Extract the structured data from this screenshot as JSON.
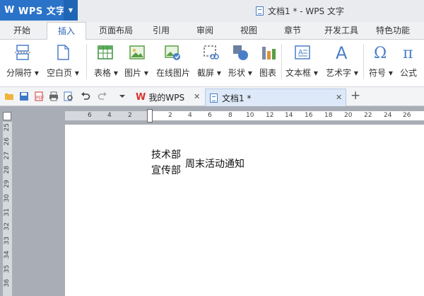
{
  "app": {
    "name": "WPS 文字",
    "logo": "W"
  },
  "window": {
    "title": "文档1 * - WPS 文字"
  },
  "menu": {
    "tabs": [
      "开始",
      "插入",
      "页面布局",
      "引用",
      "审阅",
      "视图",
      "章节",
      "开发工具",
      "特色功能"
    ],
    "active": "插入"
  },
  "ribbon": {
    "items": [
      {
        "label": "分隔符",
        "icon": "page-break-icon",
        "dropdown": true
      },
      {
        "label": "空白页",
        "icon": "blank-page-icon",
        "dropdown": true
      },
      {
        "label": "表格",
        "icon": "table-icon",
        "dropdown": true
      },
      {
        "label": "图片",
        "icon": "picture-icon",
        "dropdown": true
      },
      {
        "label": "在线图片",
        "icon": "online-picture-icon",
        "dropdown": false
      },
      {
        "label": "截屏",
        "icon": "screenshot-icon",
        "dropdown": true
      },
      {
        "label": "形状",
        "icon": "shapes-icon",
        "dropdown": true
      },
      {
        "label": "图表",
        "icon": "chart-icon",
        "dropdown": false
      },
      {
        "label": "文本框",
        "icon": "textbox-icon",
        "dropdown": true
      },
      {
        "label": "艺术字",
        "icon": "wordart-icon",
        "dropdown": true
      },
      {
        "label": "符号",
        "icon": "symbol-icon",
        "dropdown": true
      },
      {
        "label": "公式",
        "icon": "formula-icon",
        "dropdown": false
      }
    ]
  },
  "doc_tabs": [
    {
      "label": "我的WPS",
      "active": false
    },
    {
      "label": "文档1 *",
      "active": true
    }
  ],
  "ruler": {
    "h_ticks": [
      "6",
      "4",
      "2",
      "2",
      "4",
      "6",
      "8",
      "10",
      "12",
      "14",
      "16",
      "18",
      "20",
      "22",
      "24",
      "26"
    ],
    "v_ticks": [
      "25",
      "26",
      "27",
      "28",
      "29",
      "30",
      "31",
      "32",
      "33",
      "34",
      "35",
      "36"
    ]
  },
  "document": {
    "line1": "技术部",
    "line2": "宣传部",
    "side_text": "周末活动通知"
  },
  "colors": {
    "accent": "#2a73c8",
    "active_tab_text": "#2a63b8",
    "wps_red": "#d9342b"
  }
}
